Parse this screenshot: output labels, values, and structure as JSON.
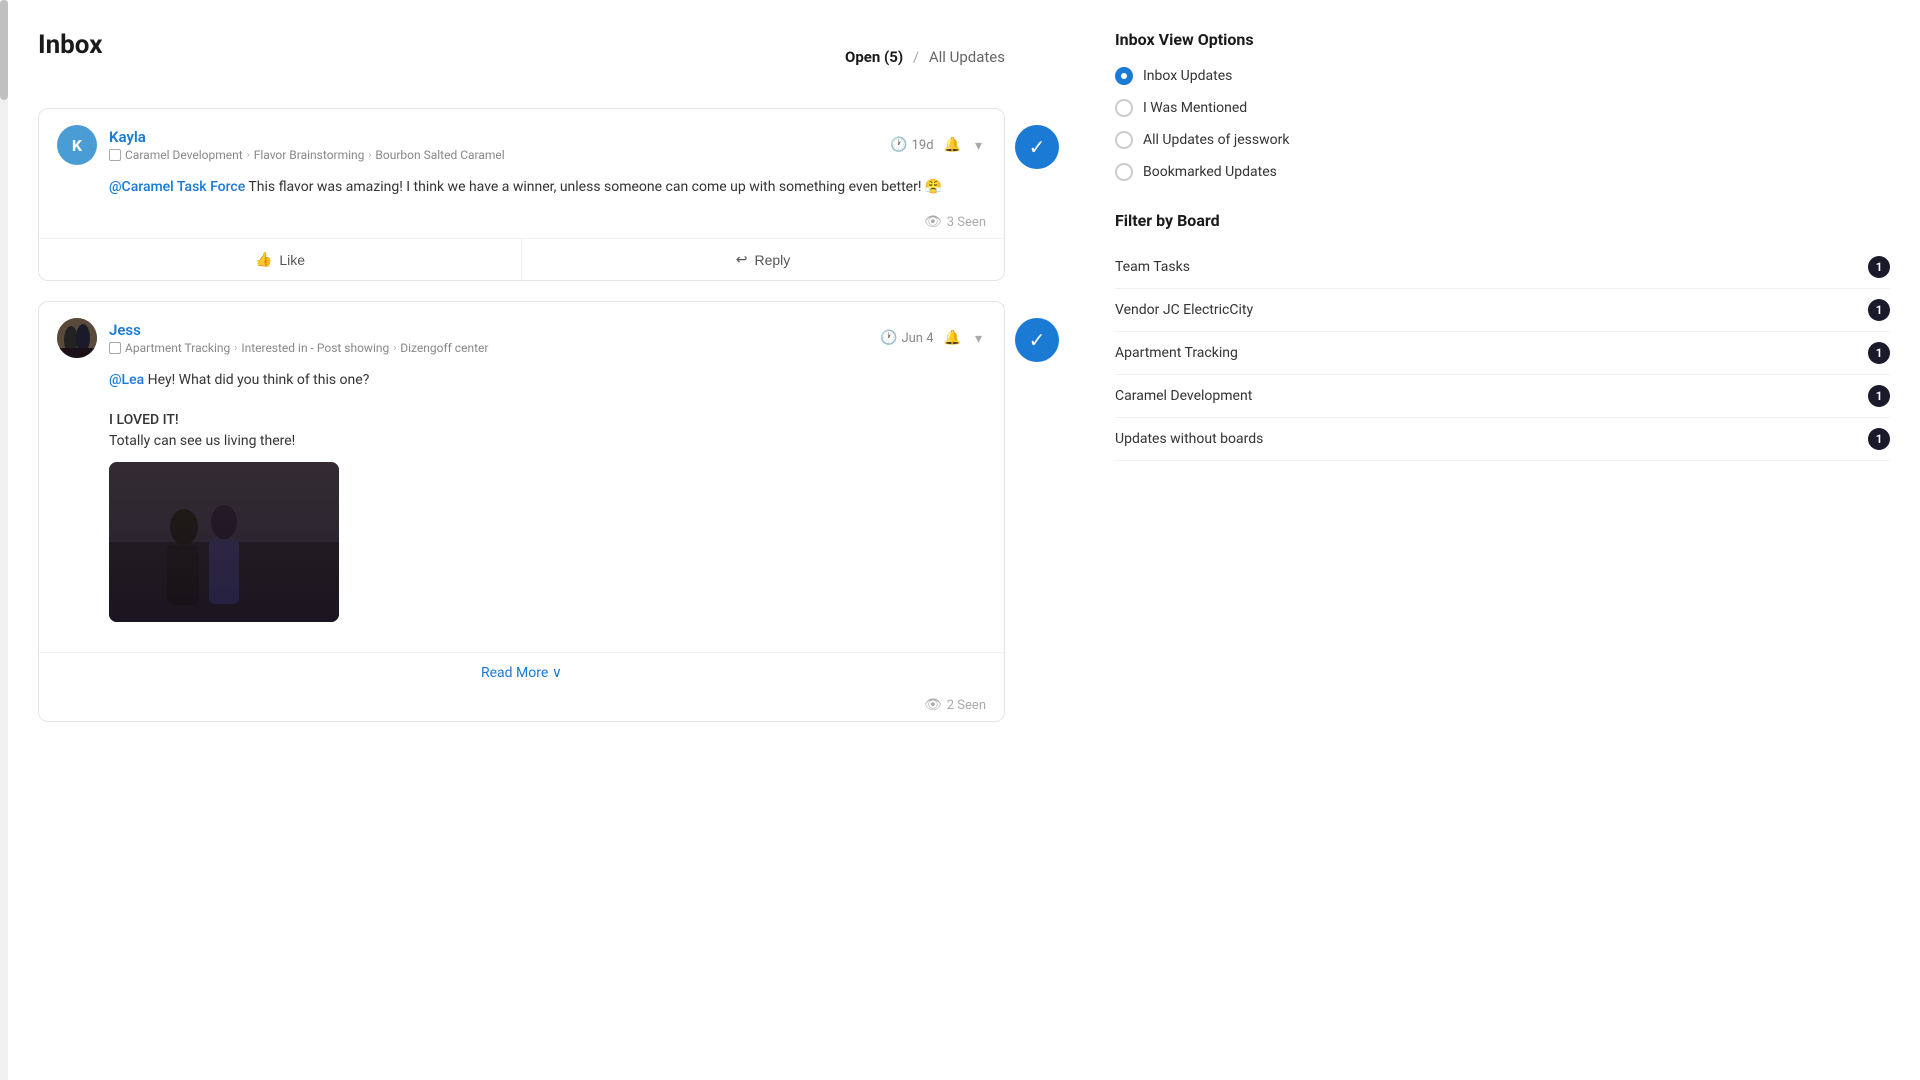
{
  "page": {
    "title": "Inbox",
    "filter": {
      "open_label": "Open (5)",
      "separator": "/",
      "all_label": "All Updates"
    }
  },
  "cards": [
    {
      "id": "card-kayla",
      "author": "Kayla",
      "avatar_letter": "K",
      "avatar_class": "avatar-kayla",
      "time": "19d",
      "breadcrumb": {
        "board": "Caramel Development",
        "sub1": "Flavor Brainstorming",
        "sub2": "Bourbon Salted Caramel"
      },
      "mention": "@Caramel Task Force",
      "text": " This flavor was amazing! I think we have a winner, unless someone can come up with something even better! 😤",
      "seen_count": "3 Seen",
      "actions": [
        "Like",
        "Reply"
      ]
    },
    {
      "id": "card-jess",
      "author": "Jess",
      "avatar_class": "avatar-jess",
      "time": "Jun 4",
      "breadcrumb": {
        "board": "Apartment Tracking",
        "sub1": "Interested in - Post showing",
        "sub2": "Dizengoff center"
      },
      "mention": "@Lea",
      "text_line1": " Hey! What did you think of this one?",
      "text_line2": "",
      "text_line3": "I LOVED IT!",
      "text_line4": "Totally can see us living there!",
      "seen_count": "2 Seen",
      "read_more": "Read More ∨"
    }
  ],
  "sidebar": {
    "view_options_title": "Inbox View Options",
    "radio_options": [
      {
        "id": "inbox-updates",
        "label": "Inbox Updates",
        "active": true
      },
      {
        "id": "i-was-mentioned",
        "label": "I Was Mentioned",
        "active": false
      },
      {
        "id": "all-updates",
        "label": "All Updates of jesswork",
        "active": false
      },
      {
        "id": "bookmarked",
        "label": "Bookmarked Updates",
        "active": false
      }
    ],
    "filter_title": "Filter by Board",
    "boards": [
      {
        "name": "Team Tasks",
        "count": 1
      },
      {
        "name": "Vendor JC ElectricCity",
        "count": 1
      },
      {
        "name": "Apartment Tracking",
        "count": 1
      },
      {
        "name": "Caramel Development",
        "count": 1
      },
      {
        "name": "Updates without boards",
        "count": 1
      }
    ]
  },
  "icons": {
    "clock": "🕐",
    "bell": "🔔",
    "dropdown": "▾",
    "eye": "👁",
    "like": "👍",
    "reply": "↩",
    "check": "✓",
    "read_more_arrow": "∨"
  }
}
